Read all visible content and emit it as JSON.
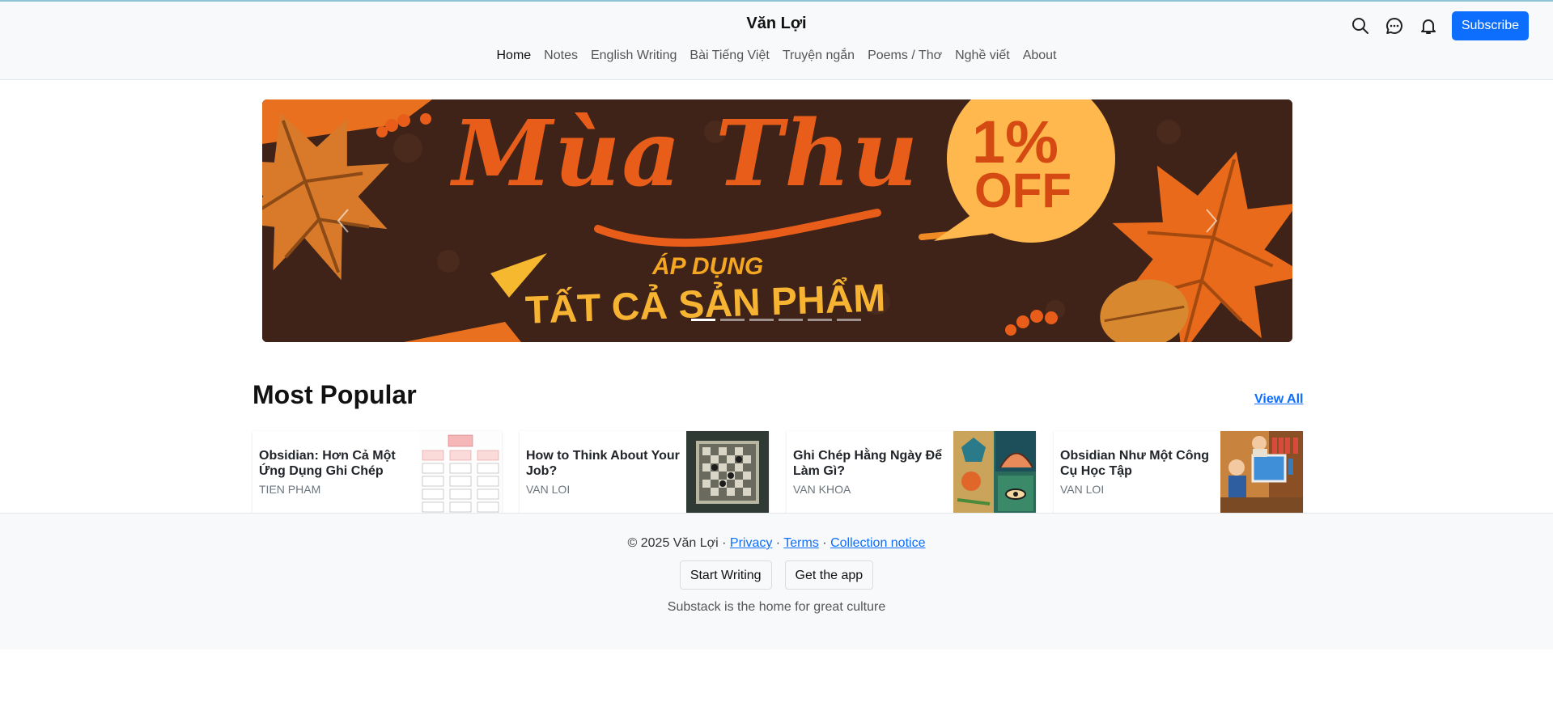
{
  "header": {
    "site_title": "Văn Lợi",
    "nav": [
      "Home",
      "Notes",
      "English Writing",
      "Bài Tiếng Việt",
      "Truyện ngắn",
      "Poems / Thơ",
      "Nghề viết",
      "About"
    ],
    "active_nav": "Home",
    "icons": [
      "search-icon",
      "chat-icon",
      "bell-icon"
    ],
    "subscribe_label": "Subscribe",
    "accent_color": "#0d6efd"
  },
  "carousel": {
    "banner": {
      "headline": "Mùa Thu",
      "badge_percent": "1%",
      "badge_off": "OFF",
      "line1": "ÁP DỤNG",
      "line2": "TẤT CẢ SẢN PHẨM"
    },
    "slide_count": 6,
    "active_slide": 1,
    "prev_icon": "chevron-left-icon",
    "next_icon": "chevron-right-icon"
  },
  "most_popular": {
    "title": "Most Popular",
    "view_all": "View All",
    "cards": [
      {
        "title": "Obsidian: Hơn Cả Một Ứng Dụng Ghi Chép",
        "author": "TIEN PHAM"
      },
      {
        "title": "How to Think About Your Job?",
        "author": "VAN LOI"
      },
      {
        "title": "Ghi Chép Hằng Ngày Để Làm Gì?",
        "author": "VAN KHOA"
      },
      {
        "title": "Obsidian Như Một Công Cụ Học Tập",
        "author": "VAN LOI"
      }
    ]
  },
  "footer": {
    "copyright": "© 2025 Văn Lợi",
    "privacy": "Privacy",
    "terms": "Terms",
    "collection": "Collection notice",
    "start_writing": "Start Writing",
    "get_app": "Get the app",
    "tagline": "Substack is the home for great culture"
  }
}
